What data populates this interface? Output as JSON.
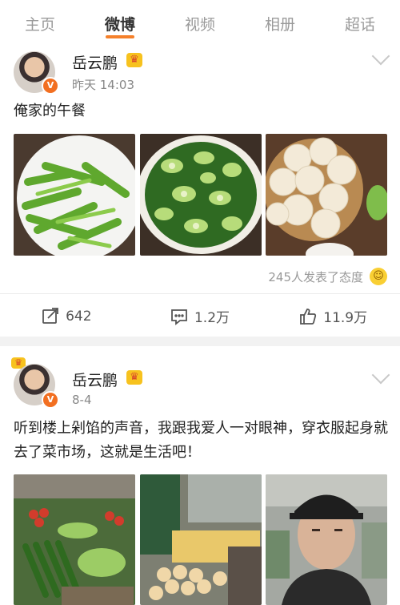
{
  "tabs": [
    {
      "label": "主页"
    },
    {
      "label": "微博",
      "active": true
    },
    {
      "label": "视频"
    },
    {
      "label": "相册"
    },
    {
      "label": "超话"
    }
  ],
  "posts": [
    {
      "author": "岳云鹏",
      "verified_badge": "V",
      "time": "昨天 14:03",
      "text": "俺家的午餐",
      "photos": [
        "stir-fried-celery",
        "smashed-cucumber-salad",
        "steamed-buns"
      ],
      "reactions_text": "245人发表了态度",
      "actions": {
        "repost": "642",
        "comment": "1.2万",
        "like": "11.9万"
      }
    },
    {
      "author": "岳云鹏",
      "verified_badge": "V",
      "time": "8-4",
      "text": "听到楼上剁馅的声音，我跟我爱人一对眼神，穿衣服起身就去了菜市场，这就是生活吧！",
      "photos": [
        "vegetable-market-stall",
        "egg-stall",
        "selfie-in-market"
      ]
    }
  ],
  "colors": {
    "accent": "#f5802a",
    "verified": "#f26f21",
    "crown": "#f7c21e"
  }
}
